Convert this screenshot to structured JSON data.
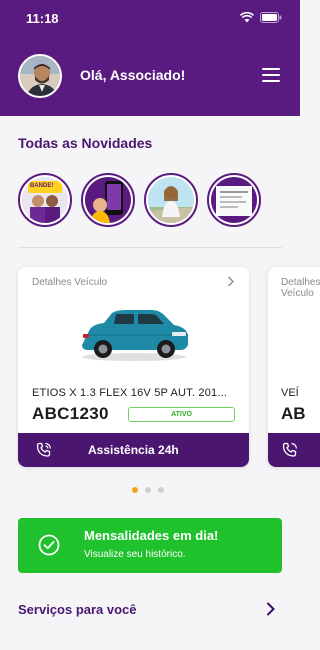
{
  "status_bar": {
    "time": "11:18"
  },
  "header": {
    "greeting": "Olá, Associado!"
  },
  "news": {
    "title": "Todas as Novidades",
    "stories": [
      {
        "label": "BANDE!"
      },
      {
        "label": ""
      },
      {
        "label": ""
      },
      {
        "label": ""
      }
    ]
  },
  "vehicles": [
    {
      "heading": "Detalhes Veículo",
      "model": "ETIOS X 1.3 FLEX 16V 5P AUT. 201...",
      "plate": "ABC1230",
      "status": "ATIVO",
      "assist_label": "Assistência 24h"
    },
    {
      "heading": "Detalhes Veículo",
      "model": "VEÍ",
      "plate": "AB"
    }
  ],
  "payment": {
    "title": "Mensalidades em dia!",
    "subtitle": "Visualize seu histórico."
  },
  "services": {
    "label": "Serviços para você"
  },
  "colors": {
    "primary": "#5a1b80",
    "success": "#1fc12d",
    "dot_active": "#f2a31b"
  }
}
